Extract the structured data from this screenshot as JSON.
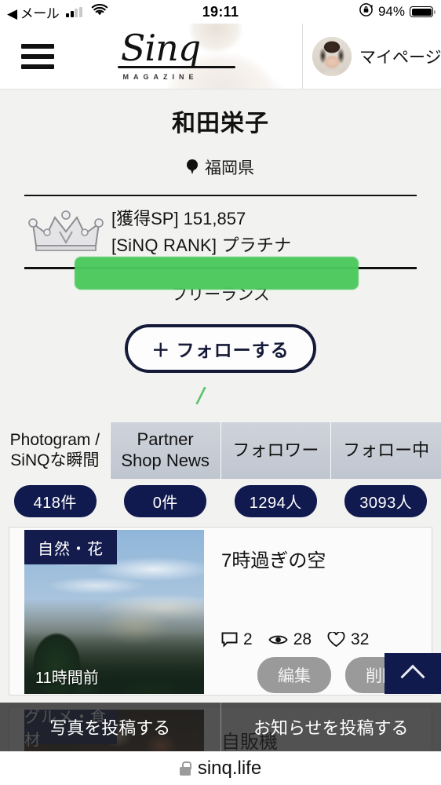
{
  "statusbar": {
    "back_app": "◀ メール",
    "time": "19:11",
    "battery_pct": "94%",
    "signal_icon": "cellular-bars-icon",
    "wifi_icon": "wifi-icon",
    "orientation_lock_icon": "rotation-lock-icon",
    "battery_icon": "battery-icon"
  },
  "header": {
    "menu_icon": "hamburger-menu-icon",
    "logo_text": "Sinq",
    "logo_subtext": "MAGAZINE",
    "mypage_label": "マイページ",
    "avatar_icon": "user-avatar"
  },
  "profile": {
    "name": "和田栄子",
    "location": "福岡県",
    "location_icon": "map-pin-icon",
    "crown_icon": "crown-icon",
    "sp_line": "[獲得SP] 151,857",
    "rank_line": "[SiNQ RANK] プラチナ",
    "job": "フリーランス",
    "follow_button": "＋ フォローする"
  },
  "annotation": {
    "highlight_color": "#4cc95d",
    "stroke_color": "#5cc36a"
  },
  "tabs": [
    {
      "label_line1": "Photogram /",
      "label_line2": "SiNQな瞬間",
      "count": "418件",
      "active": true
    },
    {
      "label_line1": "Partner",
      "label_line2": "Shop News",
      "count": "0件",
      "active": false
    },
    {
      "label_line1": "フォロワー",
      "label_line2": "",
      "count": "1294人",
      "active": false
    },
    {
      "label_line1": "フォロー中",
      "label_line2": "",
      "count": "3093人",
      "active": false
    }
  ],
  "posts": [
    {
      "category": "自然・花",
      "time_ago": "11時間前",
      "title": "7時過ぎの空",
      "comments": "2",
      "views": "28",
      "likes": "32",
      "comment_icon": "comment-bubble-icon",
      "view_icon": "eye-icon",
      "like_icon": "heart-icon",
      "edit_label": "編集",
      "delete_label": "削除"
    },
    {
      "category": "グルメ・食材",
      "title": "自販機"
    }
  ],
  "scroll_top": {
    "icon": "chevron-up-icon"
  },
  "bottom_actions": [
    {
      "label": "写真を投稿する"
    },
    {
      "label": "お知らせを投稿する"
    }
  ],
  "browser": {
    "url": "sinq.life",
    "lock_icon": "lock-icon"
  },
  "colors": {
    "navy": "#111a4e",
    "page_bg": "#f2f2f0",
    "tab_inactive": "#c5cbd4",
    "accent_green": "#4cc95d"
  }
}
